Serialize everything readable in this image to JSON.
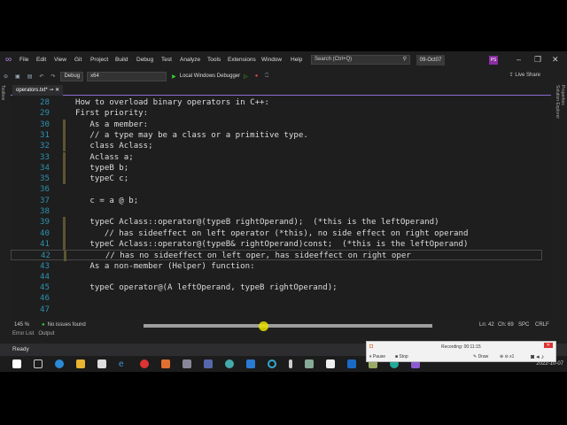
{
  "menu": [
    "File",
    "Edit",
    "View",
    "Git",
    "Project",
    "Build",
    "Debug",
    "Test",
    "Analyze",
    "Tools",
    "Extensions",
    "Window",
    "Help"
  ],
  "search_placeholder": "Search (Ctrl+Q)",
  "solution_title": "09-Oct07",
  "avatar": "PS",
  "toolbar": {
    "config": "Debug",
    "platform": "x64",
    "run": "Local Windows Debugger",
    "live_share": "Live Share"
  },
  "tab": {
    "label": "operators.txt*"
  },
  "side_left": "Toolbox",
  "side_right": [
    "Solution Explorer",
    "Properties"
  ],
  "lines": [
    {
      "n": "28",
      "t": "How to overload binary operators in C++:"
    },
    {
      "n": "29",
      "t": "First priority:"
    },
    {
      "n": "30",
      "t": "   As a member:"
    },
    {
      "n": "31",
      "t": "   // a type may be a class or a primitive type."
    },
    {
      "n": "32",
      "t": "   class Aclass;"
    },
    {
      "n": "33",
      "t": "   Aclass a;"
    },
    {
      "n": "34",
      "t": "   typeB b;"
    },
    {
      "n": "35",
      "t": "   typeC c;"
    },
    {
      "n": "36",
      "t": ""
    },
    {
      "n": "37",
      "t": "   c = a @ b;"
    },
    {
      "n": "38",
      "t": ""
    },
    {
      "n": "39",
      "t": "   typeC Aclass::operator@(typeB rightOperand);  (*this is the leftOperand)"
    },
    {
      "n": "40",
      "t": "      // has sideeffect on left operator (*this), no side effect on right operand"
    },
    {
      "n": "41",
      "t": "   typeC Aclass::operator@(typeB& rightOperand)const;  (*this is the leftOperand)"
    },
    {
      "n": "42",
      "t": "      // has no sideeffect on left oper, has sideeffect on right oper"
    },
    {
      "n": "43",
      "t": "   As a non-member (Helper) function:"
    },
    {
      "n": "44",
      "t": ""
    },
    {
      "n": "45",
      "t": "   typeC operator@(A leftOperand, typeB rightOperand);"
    },
    {
      "n": "46",
      "t": ""
    },
    {
      "n": "47",
      "t": ""
    }
  ],
  "status": {
    "zoom": "145 %",
    "issues": "No issues found",
    "ln": "Ln: 42",
    "ch": "Ch: 69",
    "spc": "SPC",
    "crlf": "CRLF"
  },
  "bottom_tabs": [
    "Error List",
    "Output"
  ],
  "ready": "Ready",
  "recorder": {
    "title": "Recording: 00:11:15",
    "pause": "Pause",
    "stop": "Stop",
    "draw": "Draw",
    "zoom": "x1"
  },
  "date": "2022-10-07"
}
